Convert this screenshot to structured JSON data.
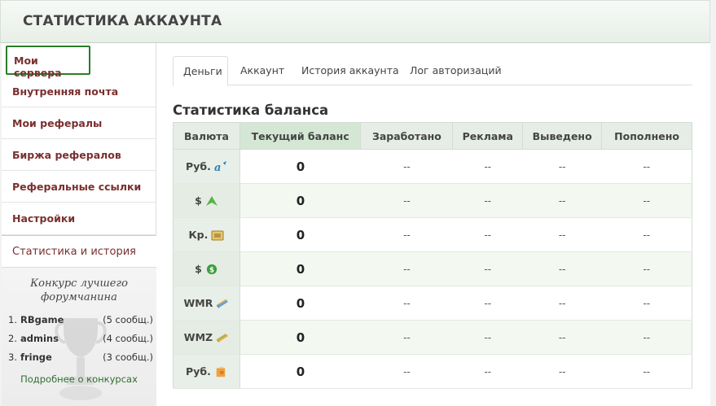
{
  "header": {
    "title": "СТАТИСТИКА АККАУНТА"
  },
  "sidebar": {
    "items": [
      {
        "label": "Мои сервера"
      },
      {
        "label": "Внутренняя почта"
      },
      {
        "label": "Мои рефералы"
      },
      {
        "label": "Биржа рефералов"
      },
      {
        "label": "Реферальные ссылки"
      },
      {
        "label": "Настройки"
      },
      {
        "label": "Статистика и история"
      }
    ],
    "contest": {
      "title_line1": "Конкурс лучшего",
      "title_line2": "форумчанина",
      "entries": [
        {
          "rank": "1.",
          "name": "RBgame",
          "count": "(5 сообщ.)"
        },
        {
          "rank": "2.",
          "name": "admins",
          "count": "(4 сообщ.)"
        },
        {
          "rank": "3.",
          "name": "fringe",
          "count": "(3 сообщ.)"
        }
      ],
      "link": "Подробнее о конкурсах"
    }
  },
  "tabs": [
    {
      "label": "Деньги"
    },
    {
      "label": "Аккаунт"
    },
    {
      "label": "История аккаунта"
    },
    {
      "label": "Лог авторизаций"
    }
  ],
  "balance": {
    "title": "Статистика баланса",
    "columns": [
      "Валюта",
      "Текущий баланс",
      "Заработано",
      "Реклама",
      "Выведено",
      "Пополнено"
    ],
    "rows": [
      {
        "currency": "Руб.",
        "icon": "advcash-icon",
        "balance": "0",
        "earned": "--",
        "ads": "--",
        "withdrawn": "--",
        "deposited": "--"
      },
      {
        "currency": "$",
        "icon": "payza-icon",
        "balance": "0",
        "earned": "--",
        "ads": "--",
        "withdrawn": "--",
        "deposited": "--"
      },
      {
        "currency": "Кр.",
        "icon": "credits-icon",
        "balance": "0",
        "earned": "--",
        "ads": "--",
        "withdrawn": "--",
        "deposited": "--"
      },
      {
        "currency": "$",
        "icon": "dollar-coin-icon",
        "balance": "0",
        "earned": "--",
        "ads": "--",
        "withdrawn": "--",
        "deposited": "--"
      },
      {
        "currency": "WMR",
        "icon": "webmoney-wmr-icon",
        "balance": "0",
        "earned": "--",
        "ads": "--",
        "withdrawn": "--",
        "deposited": "--"
      },
      {
        "currency": "WMZ",
        "icon": "webmoney-wmz-icon",
        "balance": "0",
        "earned": "--",
        "ads": "--",
        "withdrawn": "--",
        "deposited": "--"
      },
      {
        "currency": "Руб.",
        "icon": "yandex-money-icon",
        "balance": "0",
        "earned": "--",
        "ads": "--",
        "withdrawn": "--",
        "deposited": "--"
      }
    ]
  }
}
